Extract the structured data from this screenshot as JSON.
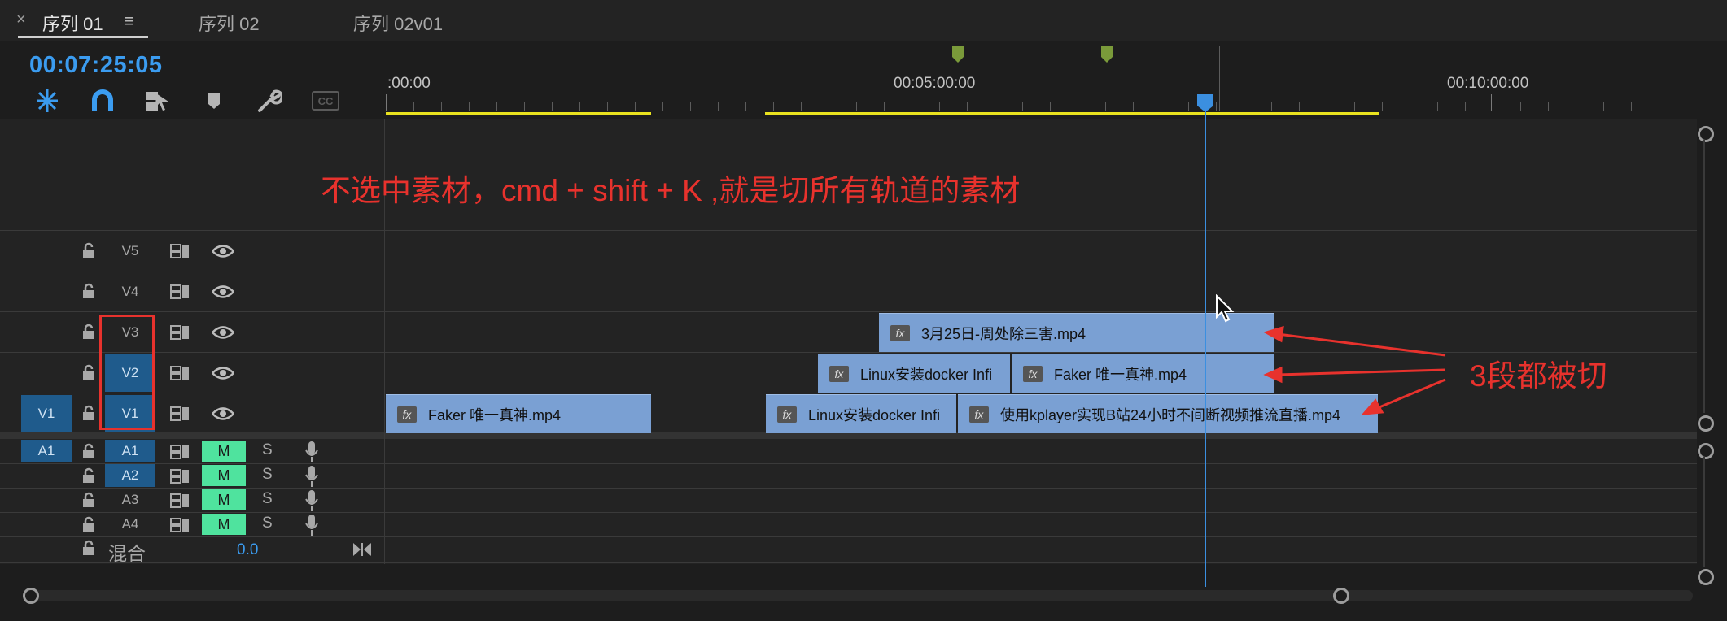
{
  "tabs": [
    {
      "label": "序列 01"
    },
    {
      "label": "序列 02"
    },
    {
      "label": "序列 02v01"
    }
  ],
  "close_glyph": "×",
  "menu_glyph": "≡",
  "timecode": "00:07:25:05",
  "toolbar": {
    "icons": [
      "snap-insert-icon",
      "magnet-icon",
      "linked-selection-icon",
      "marker-icon",
      "wrench-icon",
      "captions-icon"
    ],
    "cc_label": "CC"
  },
  "ruler": {
    "labels": [
      ":00:00",
      "00:05:00:00",
      "00:10:00:00"
    ]
  },
  "annotation_top": "不选中素材，cmd + shift + K ,就是切所有轨道的素材",
  "annotation_right": "3段都被切",
  "video_tracks": [
    {
      "label": "V5",
      "source": ""
    },
    {
      "label": "V4",
      "source": ""
    },
    {
      "label": "V3",
      "source": ""
    },
    {
      "label": "V2",
      "source": ""
    },
    {
      "label": "V1",
      "source": "V1"
    }
  ],
  "audio_tracks": [
    {
      "label": "A1",
      "source": "A1",
      "m": "M",
      "s": "S"
    },
    {
      "label": "A2",
      "source": "",
      "m": "M",
      "s": "S"
    },
    {
      "label": "A3",
      "source": "",
      "m": "M",
      "s": "S"
    },
    {
      "label": "A4",
      "source": "",
      "m": "M",
      "s": "S"
    }
  ],
  "mix": {
    "label": "混合",
    "value": "0.0"
  },
  "clips": {
    "v3_1": "3月25日-周处除三害.mp4",
    "v2_1": "Linux安装docker Infi",
    "v2_2": "Faker 唯一真神.mp4",
    "v1_1": "Faker 唯一真神.mp4",
    "v1_2": "Linux安装docker Infi",
    "v1_3": "使用kplayer实现B站24小时不间断视频推流直播.mp4"
  },
  "fx_label": "fx",
  "colors": {
    "accent": "#3b9cf0",
    "clip": "#7aa0d3",
    "mute_on": "#4fe39e",
    "annotation": "#e8322d",
    "work_area": "#e9e21f"
  }
}
